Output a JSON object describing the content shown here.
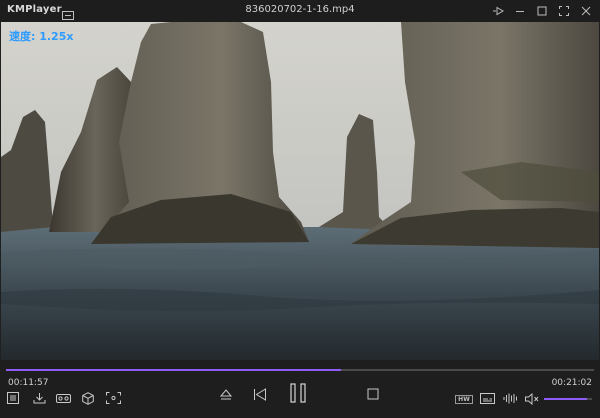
{
  "window": {
    "app_name": "KMPlayer",
    "file_title": "836020702-1-16.mp4"
  },
  "video": {
    "speed_osd": "速度: 1.25x"
  },
  "playback": {
    "current_time": "00:11:57",
    "duration": "00:21:02",
    "progress": 0.57,
    "volume": 0.9
  },
  "colors": {
    "accent": "#8e5cf6",
    "osd_text": "#2e9bff"
  },
  "icons": {
    "left_group": [
      "playlist-icon",
      "download-icon",
      "vr-goggles-icon",
      "3d-cube-icon",
      "screen-capture-icon"
    ],
    "center_group": [
      "eject-icon",
      "previous-icon",
      "pause-icon",
      "stop-icon"
    ],
    "right_group": [
      "hw-decoder-icon",
      "subtitle-icon",
      "audio-wave-icon",
      "speaker-icon"
    ]
  },
  "labels": {
    "hw_badge": "HW"
  }
}
